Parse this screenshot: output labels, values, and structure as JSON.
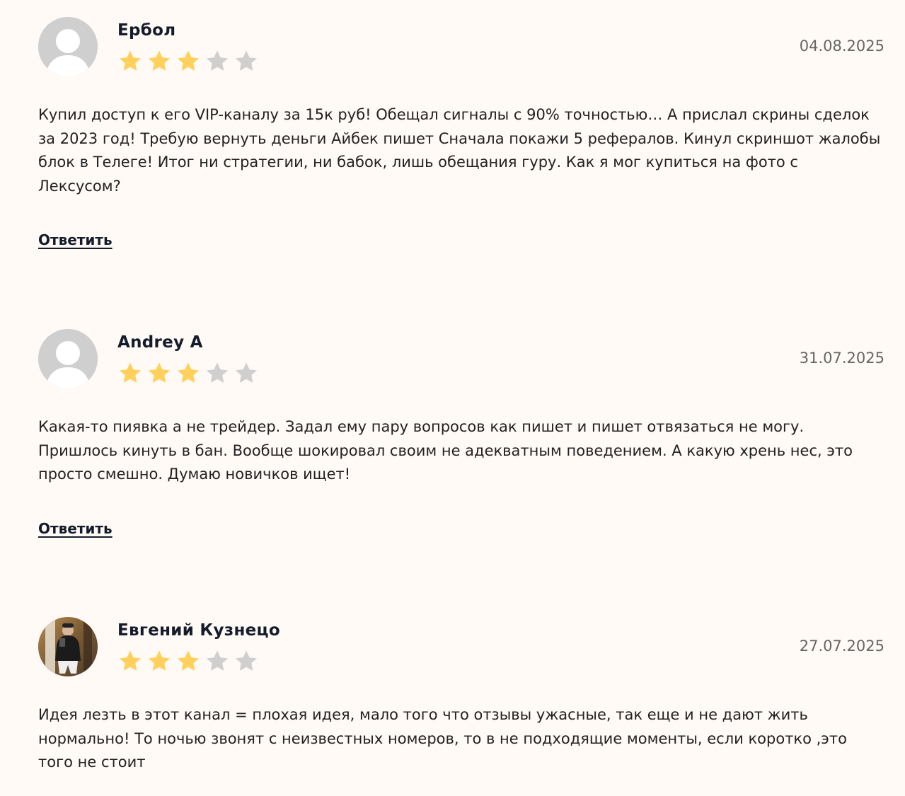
{
  "reviews": [
    {
      "name": "Ербол",
      "date": "04.08.2025",
      "rating": 3,
      "max_rating": 5,
      "avatar": "default-user-avatar",
      "text": "Купил доступ к его VIP-каналу за 15к руб! Обещал сигналы с 90% точностью… А прислал скрины сделок за 2023 год! Требую вернуть деньги Айбек пишет Сначала покажи 5 рефералов. Кинул скриншот жалобы блок в Телеге! Итог ни стратегии, ни бабок, лишь обещания гуру. Как я мог купиться на фото с Лексусом?",
      "reply_label": "Ответить"
    },
    {
      "name": "Andrey A",
      "date": "31.07.2025",
      "rating": 3,
      "max_rating": 5,
      "avatar": "default-user-avatar",
      "text": "Какая-то пиявка а не трейдер. Задал ему пару вопросов как пишет и пишет отвязаться не могу. Пришлось кинуть в бан. Вообще шокировал своим не адекватным поведением. А какую хрень нес, это просто смешно. Думаю новичков ищет!",
      "reply_label": "Ответить"
    },
    {
      "name": "Евгений Кузнецо",
      "date": "27.07.2025",
      "rating": 3,
      "max_rating": 5,
      "avatar": "user-photo-avatar",
      "text": "Идея лезть в этот канал = плохая идея, мало того что отзывы ужасные, так еще и не дают жить нормально! То ночью звонят с неизвестных номеров, то в не подходящие моменты, если коротко ,это того не стоит"
    }
  ],
  "colors": {
    "background": "#fffaf6",
    "star_filled": "#ffd15c",
    "star_empty": "#cfcfcf",
    "name": "#141c2b",
    "date": "#666666"
  }
}
